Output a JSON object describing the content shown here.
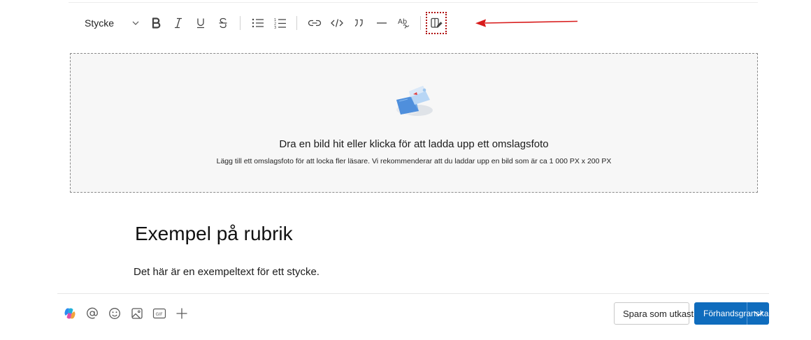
{
  "toolbar": {
    "style_label": "Stycke"
  },
  "dropzone": {
    "title": "Dra en bild hit eller klicka för att ladda upp ett omslagsfoto",
    "subtitle": "Lägg till ett omslagsfoto för att locka fler läsare. Vi rekommenderar att du laddar upp en bild som är ca 1 000 PX x 200 PX"
  },
  "content": {
    "heading": "Exempel på rubrik",
    "paragraph": "Det här är en exempeltext för ett stycke."
  },
  "footer": {
    "draft_label": "Spara som utkast",
    "preview_label": "Förhandsgranska",
    "gif_label": "GIF"
  },
  "colors": {
    "accent": "#0f6cbd",
    "annotation": "#d81b1b"
  }
}
